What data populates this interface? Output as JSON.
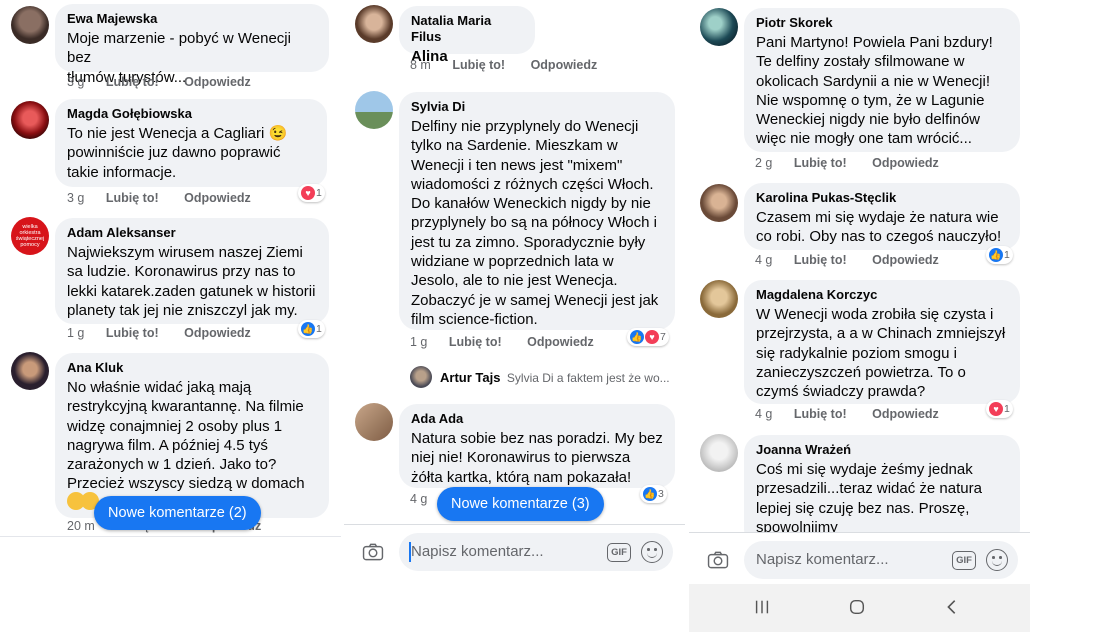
{
  "panel1": {
    "comments": [
      {
        "name": "Ewa Majewska",
        "text": "Moje marzenie - pobyć w Wenecji bez\ntłumów turystów...",
        "time": "3 g",
        "like": "Lubię to!",
        "reply": "Odpowiedz"
      },
      {
        "name": "Magda Gołębiowska",
        "text": "To nie jest Wenecja a Cagliari 😉\npowinniście juz dawno poprawić\ntakie informacje.",
        "time": "3 g",
        "like": "Lubię to!",
        "reply": "Odpowiedz",
        "reaction_count": "1"
      },
      {
        "name": "Adam Aleksanser",
        "avatar_text": "wielka orkiestra świątecznej pomocy",
        "text": "Najwiekszym wirusem naszej Ziemi\nsa ludzie. Koronawirus przy nas to\nlekki katarek.zaden gatunek w historii\nplanety tak jej nie zniszczyl jak my.",
        "time": "1 g",
        "like": "Lubię to!",
        "reply": "Odpowiedz",
        "reaction_count": "1"
      },
      {
        "name": "Ana Kluk",
        "text": "No właśnie widać jaką mają\nrestrykcyjną kwarantannę. Na filmie\nwidzę conajmniej 2 osoby plus 1\nnagrywa film. A później 4.5 tyś\nzarażonych w 1 dzień. Jako to?\nPrzecież wszyscy siedzą w domach",
        "time": "20 m",
        "like": "Lubię to!",
        "reply": "Odpowiedz"
      }
    ],
    "new_comments": "Nowe komentarze (2)"
  },
  "panel2": {
    "comments": [
      {
        "name": "Natalia Maria Filus",
        "text": "Alina",
        "time": "8 m",
        "like": "Lubię to!",
        "reply": "Odpowiedz"
      },
      {
        "name": "Sylvia Di",
        "text": "Delfiny nie przyplynely do Wenecji\ntylko na Sardenie. Mieszkam w\nWenecji i ten news jest \"mixem\"\nwiadomości z różnych części Włoch.\nDo kanałów Weneckich nigdy by nie\nprzyplynely bo są na północy Włoch i\njest tu za zimno. Sporadycznie były\nwidziane w poprzednich lata w\nJesolo, ale to nie jest Wenecja.\nZobaczyć je w samej Wenecji jest jak\nfilm science-fiction.",
        "time": "1 g",
        "like": "Lubię to!",
        "reply": "Odpowiedz",
        "reaction_count": "7"
      },
      {
        "name": "Ada Ada",
        "text": "Natura sobie bez nas poradzi. My bez\nniej nie! Koronawirus to pierwsza\nżółta kartka, którą nam pokazała!",
        "time": "4 g",
        "reaction_count": "3"
      }
    ],
    "reply": {
      "name": "Artur Tajs",
      "text": "Sylvia Di a faktem jest że wo..."
    },
    "new_comments": "Nowe komentarze (3)",
    "composer_placeholder": "Napisz komentarz...",
    "gif_label": "GIF"
  },
  "panel3": {
    "comments": [
      {
        "name": "Piotr Skorek",
        "text": "Pani Martyno! Powiela Pani bzdury!\nTe delfiny zostały sfilmowane w\nokolicach Sardynii a nie w Wenecji!\nNie wspomnę o tym, że w Lagunie\nWeneckiej nigdy nie było delfinów\nwięc nie mogły one tam wrócić...",
        "time": "2 g",
        "like": "Lubię to!",
        "reply": "Odpowiedz"
      },
      {
        "name": "Karolina Pukas-Stęclik",
        "text": "Czasem mi się wydaje że natura wie\nco robi. Oby nas to czegoś nauczyło!",
        "time": "4 g",
        "like": "Lubię to!",
        "reply": "Odpowiedz",
        "reaction_count": "1"
      },
      {
        "name": "Magdalena Korczyc",
        "text": "W Wenecji woda zrobiła się czysta i\nprzejrzysta, a a w Chinach zmniejszył\nsię radykalnie poziom smogu i\nzanieczyszczeń powietrza. To o\nczymś świadczy prawda?",
        "time": "4 g",
        "like": "Lubię to!",
        "reply": "Odpowiedz",
        "reaction_count": "1"
      },
      {
        "name": "Joanna Wrażeń",
        "text": "Coś mi się wydaje żeśmy jednak\nprzesadzili...teraz widać że natura\nlepiej się czuję bez nas. Proszę,\nspowolnijmy"
      }
    ],
    "composer_placeholder": "Napisz komentarz...",
    "gif_label": "GIF"
  },
  "colors": {
    "accent": "#1877f2",
    "bubble": "#f0f2f5",
    "meta": "#65676b",
    "love": "#f33e58"
  },
  "icons": [
    "camera-icon",
    "gif-icon",
    "emoji-icon",
    "like-reaction-icon",
    "love-reaction-icon",
    "recent-apps-icon",
    "home-icon",
    "back-icon"
  ]
}
